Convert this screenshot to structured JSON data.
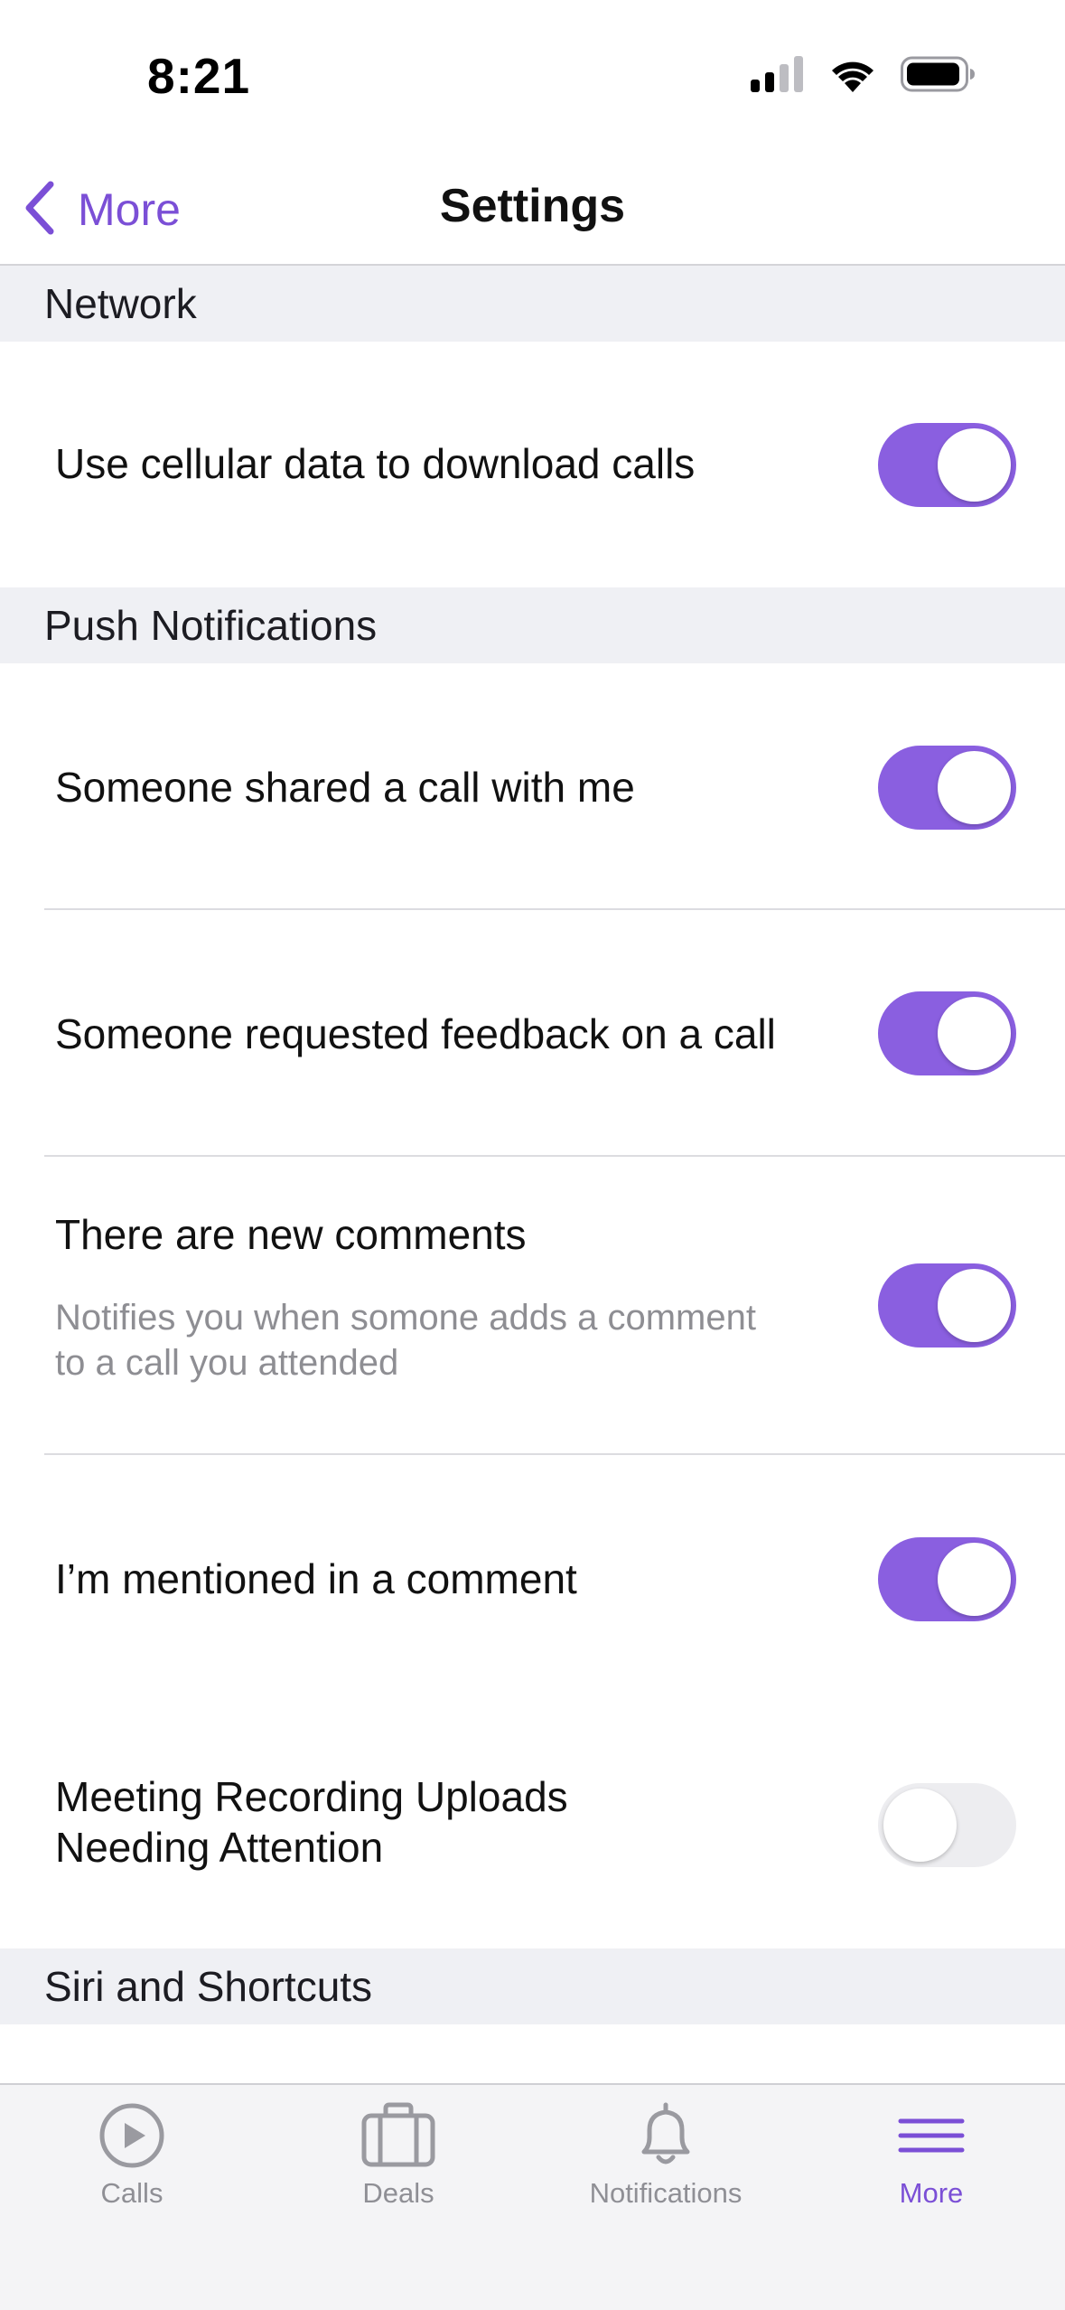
{
  "status_bar": {
    "time": "8:21"
  },
  "nav": {
    "back_label": "More",
    "title": "Settings"
  },
  "sections": {
    "network": "Network",
    "push": "Push Notifications",
    "siri": "Siri and Shortcuts"
  },
  "settings": {
    "cellular": {
      "label": "Use cellular data to download calls",
      "enabled": true
    },
    "shared_call": {
      "label": "Someone shared a call with me",
      "enabled": true
    },
    "feedback": {
      "label": "Someone requested feedback on a call",
      "enabled": true
    },
    "comments": {
      "label": "There are new comments",
      "sub_line1": "Notifies you when somone adds a comment",
      "sub_line2": "to a call you attended",
      "enabled": true
    },
    "mentioned": {
      "label": "I’m mentioned in a comment",
      "enabled": true
    },
    "recording": {
      "label_line1": "Meeting Recording Uploads",
      "label_line2": "Needing Attention",
      "enabled": false
    }
  },
  "tabs": {
    "calls": "Calls",
    "deals": "Deals",
    "notifications": "Notifications",
    "more": "More",
    "active": "more"
  },
  "colors": {
    "accent": "#8a5fe0",
    "accent_text": "#7b4fd6",
    "section_bg": "#eff0f4",
    "toggle_off": "#ededf0",
    "secondary_text": "#8e8e93"
  }
}
